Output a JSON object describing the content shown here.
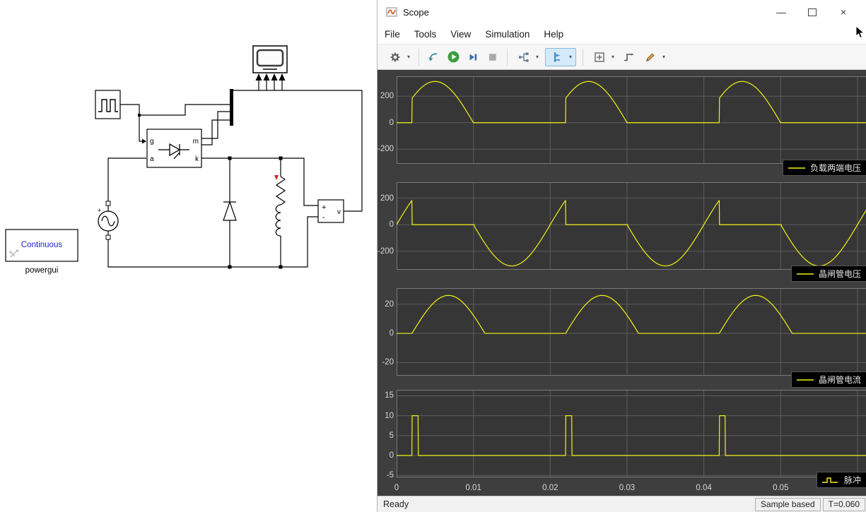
{
  "window": {
    "title": "Scope",
    "minimize_glyph": "—",
    "close_glyph": "×"
  },
  "menu": {
    "items": [
      "File",
      "Tools",
      "View",
      "Simulation",
      "Help"
    ]
  },
  "toolbar": {
    "icons": [
      "settings-gear",
      "highlight-block",
      "run",
      "step-forward",
      "stop",
      "signal-selector",
      "cursor-measurements",
      "span-zoom",
      "trigger",
      "highlight-pen"
    ]
  },
  "status": {
    "ready": "Ready",
    "sample_based": "Sample based",
    "time": "T=0.060"
  },
  "colors": {
    "powergui_blue": "#2222cc",
    "trace_yellow": "#f3f314",
    "run_green": "#3f9e3f",
    "step_blue": "#3a6fb0",
    "red_marker": "#cc2222"
  },
  "model": {
    "powergui": {
      "title": "Continuous",
      "name": "powergui"
    },
    "thyristor": {
      "g": "g",
      "m": "m",
      "a": "a",
      "k": "k"
    },
    "vmeter": {
      "plus": "+",
      "minus": "-",
      "v": "v"
    },
    "source": {
      "plus": "+"
    }
  },
  "chart_data": [
    {
      "type": "line",
      "legend": "负载两端电压",
      "xlim": [
        0,
        0.0612
      ],
      "ylim": [
        -310,
        350
      ],
      "yticks": [
        {
          "v": 200,
          "label": "200"
        },
        {
          "v": 0,
          "label": "0"
        },
        {
          "v": -200,
          "label": "-200"
        }
      ],
      "grid_x": [
        0.01,
        0.02,
        0.03,
        0.04,
        0.05,
        0.06
      ],
      "line_color": "#f3f314",
      "signal": {
        "kind": "gated_sine",
        "amplitude": 311,
        "period": 0.02,
        "on_from": 0.002,
        "on_to": 0.01
      },
      "description": "Load terminal voltage: half-sine conduction pulses, peak 311 V, firing 2 ms into each 20 ms period"
    },
    {
      "type": "line",
      "legend": "晶闸管电压",
      "xlim": [
        0,
        0.0612
      ],
      "ylim": [
        -340,
        320
      ],
      "yticks": [
        {
          "v": 200,
          "label": "200"
        },
        {
          "v": 0,
          "label": "0"
        },
        {
          "v": -200,
          "label": "-200"
        }
      ],
      "grid_x": [
        0.01,
        0.02,
        0.03,
        0.04,
        0.05,
        0.06
      ],
      "line_color": "#f3f314",
      "signal": {
        "kind": "blocking_sine",
        "amplitude": 311,
        "period": 0.02,
        "conduct_from": 0.002,
        "conduct_to": 0.0101
      },
      "description": "Thyristor voltage: follows 311 V source sine while blocking, zero while conducting (2-10 ms each period)"
    },
    {
      "type": "line",
      "legend": "晶闸管电流",
      "xlim": [
        0,
        0.0612
      ],
      "ylim": [
        -29,
        31
      ],
      "yticks": [
        {
          "v": 20,
          "label": "20"
        },
        {
          "v": 0,
          "label": "0"
        },
        {
          "v": -20,
          "label": "-20"
        }
      ],
      "grid_x": [
        0.01,
        0.02,
        0.03,
        0.04,
        0.05,
        0.06
      ],
      "line_color": "#f3f314",
      "signal": {
        "kind": "half_sine_pulse",
        "amplitude": 26,
        "period": 0.02,
        "start": 0.002,
        "end": 0.0115
      },
      "description": "Thyristor current: ~26 A half-sine pulses from 2 ms to 11.5 ms of each 20 ms period"
    },
    {
      "type": "line",
      "legend": "脉冲",
      "xlim": [
        0,
        0.0612
      ],
      "ylim": [
        -5.5,
        16.5
      ],
      "yticks": [
        {
          "v": 15,
          "label": "15"
        },
        {
          "v": 10,
          "label": "10"
        },
        {
          "v": 5,
          "label": "5"
        },
        {
          "v": 0,
          "label": "0"
        },
        {
          "v": -5,
          "label": "-5"
        }
      ],
      "xticks": [
        {
          "v": 0,
          "label": "0"
        },
        {
          "v": 0.01,
          "label": "0.01"
        },
        {
          "v": 0.02,
          "label": "0.02"
        },
        {
          "v": 0.03,
          "label": "0.03"
        },
        {
          "v": 0.04,
          "label": "0.04"
        },
        {
          "v": 0.05,
          "label": "0.05"
        }
      ],
      "grid_x": [
        0.01,
        0.02,
        0.03,
        0.04,
        0.05,
        0.06
      ],
      "line_color": "#f3f314",
      "signal": {
        "kind": "rect_pulse",
        "high": 10,
        "low": 0,
        "period": 0.02,
        "start": 0.002,
        "width": 0.0008
      },
      "description": "Gate pulse train: amplitude 10, narrow pulses at 2 ms, 22 ms, 42 ms"
    }
  ]
}
